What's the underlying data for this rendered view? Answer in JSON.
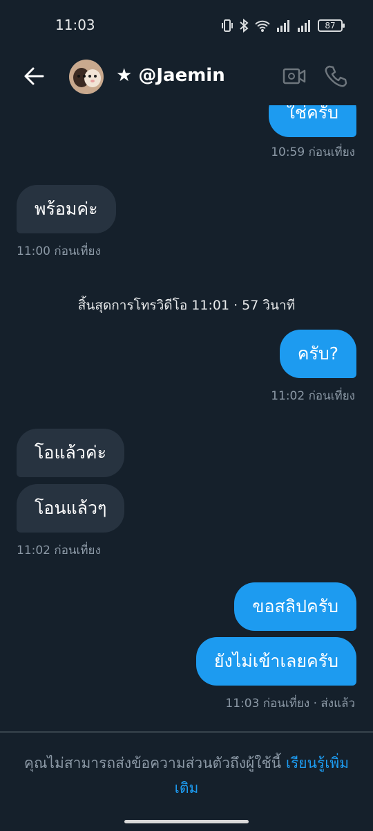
{
  "status_bar": {
    "time": "11:03",
    "battery": "87"
  },
  "header": {
    "contact_name": "★ @Jaemin"
  },
  "messages": [
    {
      "direction": "out",
      "text": "ใช่ครับ",
      "meta": "10:59 ก่อนเที่ยง"
    },
    {
      "direction": "in",
      "text": "พร้อมค่ะ",
      "meta": "11:00 ก่อนเที่ยง"
    },
    {
      "direction": "system",
      "text": "สิ้นสุดการโทรวิดีโอ 11:01 · 57 วินาที"
    },
    {
      "direction": "out",
      "text": "ครับ?",
      "meta": "11:02 ก่อนเที่ยง"
    },
    {
      "direction": "in",
      "text": "โอแล้วค่ะ"
    },
    {
      "direction": "in",
      "text": "โอนแล้วๆ",
      "meta": "11:02 ก่อนเที่ยง"
    },
    {
      "direction": "out",
      "text": "ขอสลิปครับ"
    },
    {
      "direction": "out",
      "text": "ยังไม่เข้าเลยครับ",
      "meta": "11:03 ก่อนเที่ยง · ส่งแล้ว"
    }
  ],
  "footer": {
    "notice": "คุณไม่สามารถส่งข้อความส่วนตัวถึงผู้ใช้นี้ ",
    "link_label": "เรียนรู้เพิ่มเติม"
  },
  "colors": {
    "background": "#15202b",
    "outgoing_bubble": "#1d9bf0",
    "incoming_bubble": "#273340",
    "muted_text": "#8b98a5",
    "link": "#1d9bf0"
  },
  "icons": {
    "back": "arrow-left-icon",
    "video": "video-camera-icon",
    "call": "phone-icon"
  }
}
